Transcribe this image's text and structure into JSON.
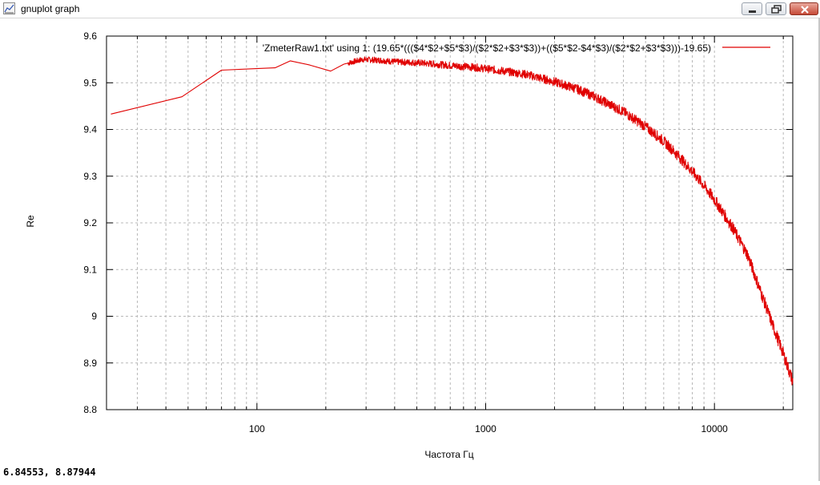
{
  "window": {
    "title": "gnuplot graph",
    "icon": "graph-app-icon",
    "controls": [
      "minimize-icon",
      "restore-icon",
      "close-icon"
    ]
  },
  "status": {
    "coordinates": "6.84553, 8.87944"
  },
  "chart_data": {
    "type": "line",
    "xlabel": "Частота Гц",
    "ylabel": "Re",
    "xscale": "log",
    "xlim": [
      22,
      22000
    ],
    "ylim": [
      8.8,
      9.6
    ],
    "x_ticks": [
      100,
      1000,
      10000
    ],
    "x_tick_labels": [
      "100",
      "1000",
      "10000"
    ],
    "y_ticks": [
      8.8,
      8.9,
      9,
      9.1,
      9.2,
      9.3,
      9.4,
      9.5,
      9.6
    ],
    "y_tick_labels": [
      "8.8",
      "8.9",
      "9",
      "9.1",
      "9.2",
      "9.3",
      "9.4",
      "9.5",
      "9.6"
    ],
    "grid": true,
    "legend_position": "top-right",
    "series": [
      {
        "name": "'ZmeterRaw1.txt' using 1: (19.65*((($4*$2+$5*$3)/($2*$2+$3*$3))+(($5*$2-$4*$3)/($2*$2+$3*$3)))-19.65)",
        "color": "#e00000",
        "x": [
          23,
          47,
          70,
          95,
          120,
          140,
          170,
          210,
          240,
          290,
          350,
          400,
          500,
          600,
          700,
          800,
          900,
          1000,
          1200,
          1500,
          2000,
          2500,
          3000,
          4000,
          5000,
          6000,
          7000,
          8000,
          9000,
          10000,
          12000,
          14000,
          16000,
          18000,
          20000,
          22000
        ],
        "y": [
          9.433,
          9.47,
          9.527,
          9.53,
          9.532,
          9.547,
          9.538,
          9.525,
          9.54,
          9.55,
          9.548,
          9.545,
          9.543,
          9.54,
          9.537,
          9.535,
          9.533,
          9.53,
          9.525,
          9.518,
          9.502,
          9.487,
          9.47,
          9.438,
          9.406,
          9.375,
          9.342,
          9.31,
          9.28,
          9.25,
          9.19,
          9.13,
          9.05,
          8.98,
          8.92,
          8.86
        ]
      }
    ]
  }
}
